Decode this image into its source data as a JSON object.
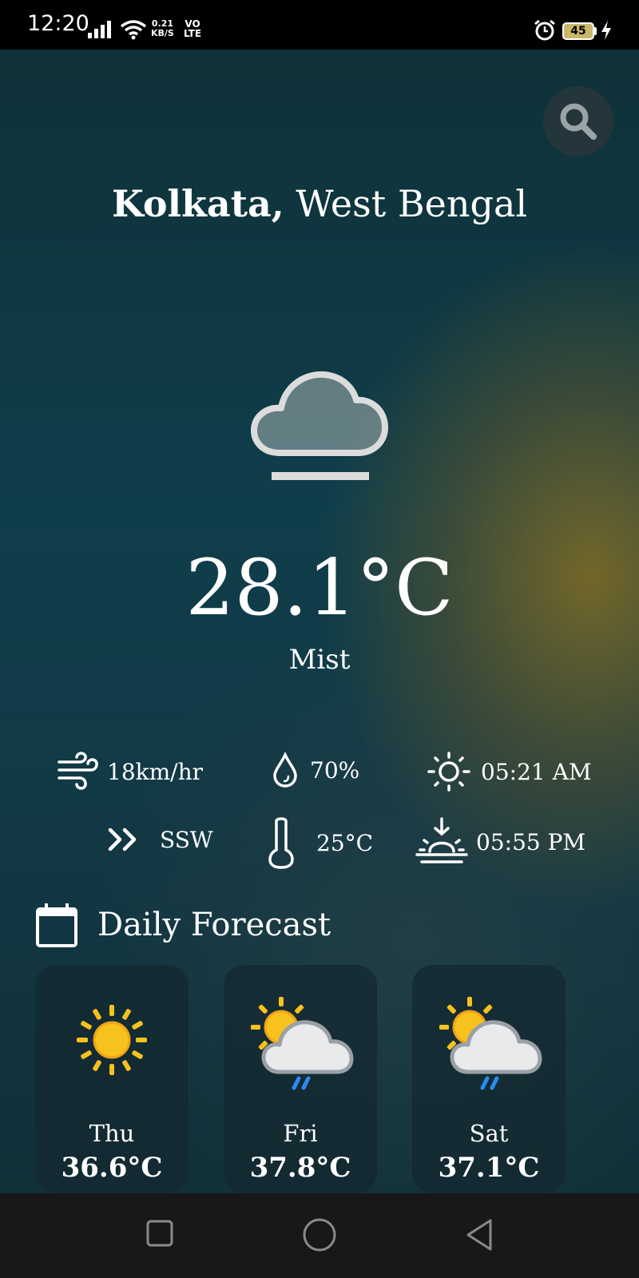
{
  "status_bar": {
    "time": "12:20",
    "speed_value": "0.21",
    "speed_unit": "KB/S",
    "volte_top": "VO",
    "volte_bottom": "LTE",
    "battery": "45"
  },
  "location": {
    "city": "Kolkata,",
    "region": "West Bengal"
  },
  "current": {
    "temperature": "28.1°C",
    "description": "Mist",
    "icon": "mist-cloud-icon"
  },
  "stats": {
    "wind_speed": "18km/hr",
    "humidity": "70%",
    "sunrise": "05:21 AM",
    "wind_direction": "SSW",
    "feels_like": "25°C",
    "sunset": "05:55 PM"
  },
  "forecast": {
    "title": "Daily Forecast",
    "days": [
      {
        "day": "Thu",
        "temp": "36.6°C",
        "icon": "sun-icon"
      },
      {
        "day": "Fri",
        "temp": "37.8°C",
        "icon": "sun-cloud-rain-icon"
      },
      {
        "day": "Sat",
        "temp": "37.1°C",
        "icon": "sun-cloud-rain-icon"
      }
    ]
  },
  "colors": {
    "sun": "#f7c21c",
    "cloud": "#e9eaec",
    "rain": "#2a8bf2"
  }
}
